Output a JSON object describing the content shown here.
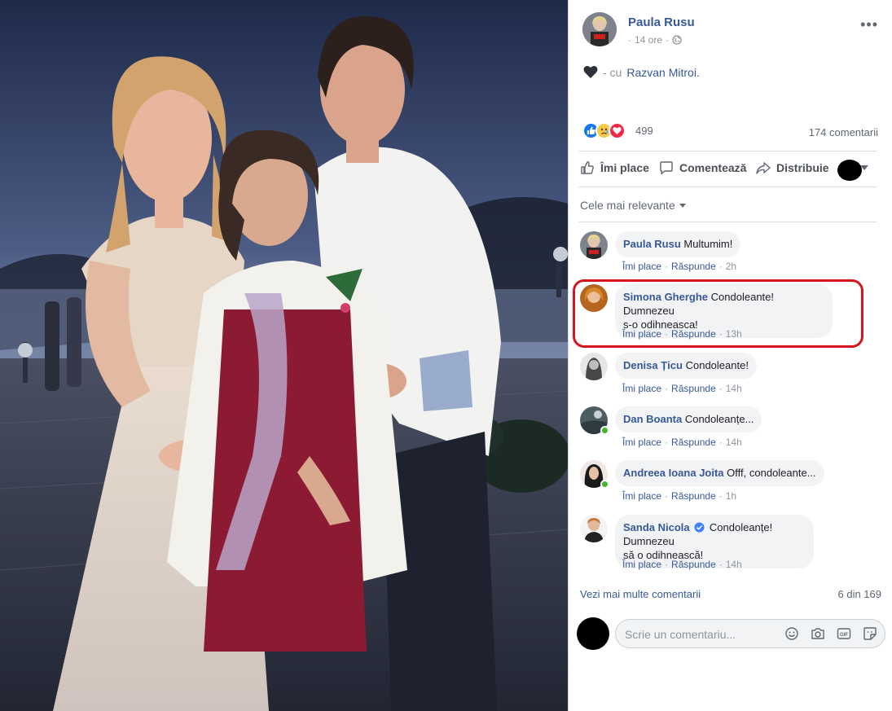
{
  "post": {
    "author": "Paula Rusu",
    "time": "14 ore",
    "separator": "·",
    "with_text": "- cu",
    "tagged": "Razvan Mitroi.",
    "heart_emoji_name": "black-heart-icon",
    "reaction_count": "499",
    "comment_count": "174 comentarii"
  },
  "actions": {
    "like": "Îmi place",
    "comment": "Comentează",
    "share": "Distribuie"
  },
  "sort": {
    "label": "Cele mai relevante"
  },
  "comments": [
    {
      "name": "Paula Rusu",
      "text": "Multumim!",
      "like": "Îmi place",
      "reply": "Răspunde",
      "time": "2h"
    },
    {
      "name": "Simona Gherghe",
      "text": "Condoleante! Dumnezeu",
      "text2": "s-o odihneasca!",
      "like": "Îmi place",
      "reply": "Răspunde",
      "time": "13h"
    },
    {
      "name": "Denisa Țicu",
      "text": "Condoleante!",
      "like": "Îmi place",
      "reply": "Răspunde",
      "time": "14h"
    },
    {
      "name": "Dan Boanta",
      "text": "Condoleanțe...",
      "like": "Îmi place",
      "reply": "Răspunde",
      "time": "14h"
    },
    {
      "name": "Andreea Ioana Joita",
      "text": "Offf, condoleante...",
      "like": "Îmi place",
      "reply": "Răspunde",
      "time": "1h"
    },
    {
      "name": "Sanda Nicola",
      "text": "Condoleanțe! Dumnezeu",
      "text2": "să o odihnească!",
      "like": "Îmi place",
      "reply": "Răspunde",
      "time": "14h"
    }
  ],
  "more": {
    "label": "Vezi mai multe comentarii",
    "count": "6 din 169"
  },
  "composer": {
    "placeholder": "Scrie un comentariu..."
  },
  "colors": {
    "link": "#385898",
    "highlight": "#d6161e",
    "bubble": "#f2f3f5",
    "online": "#42b72a"
  }
}
